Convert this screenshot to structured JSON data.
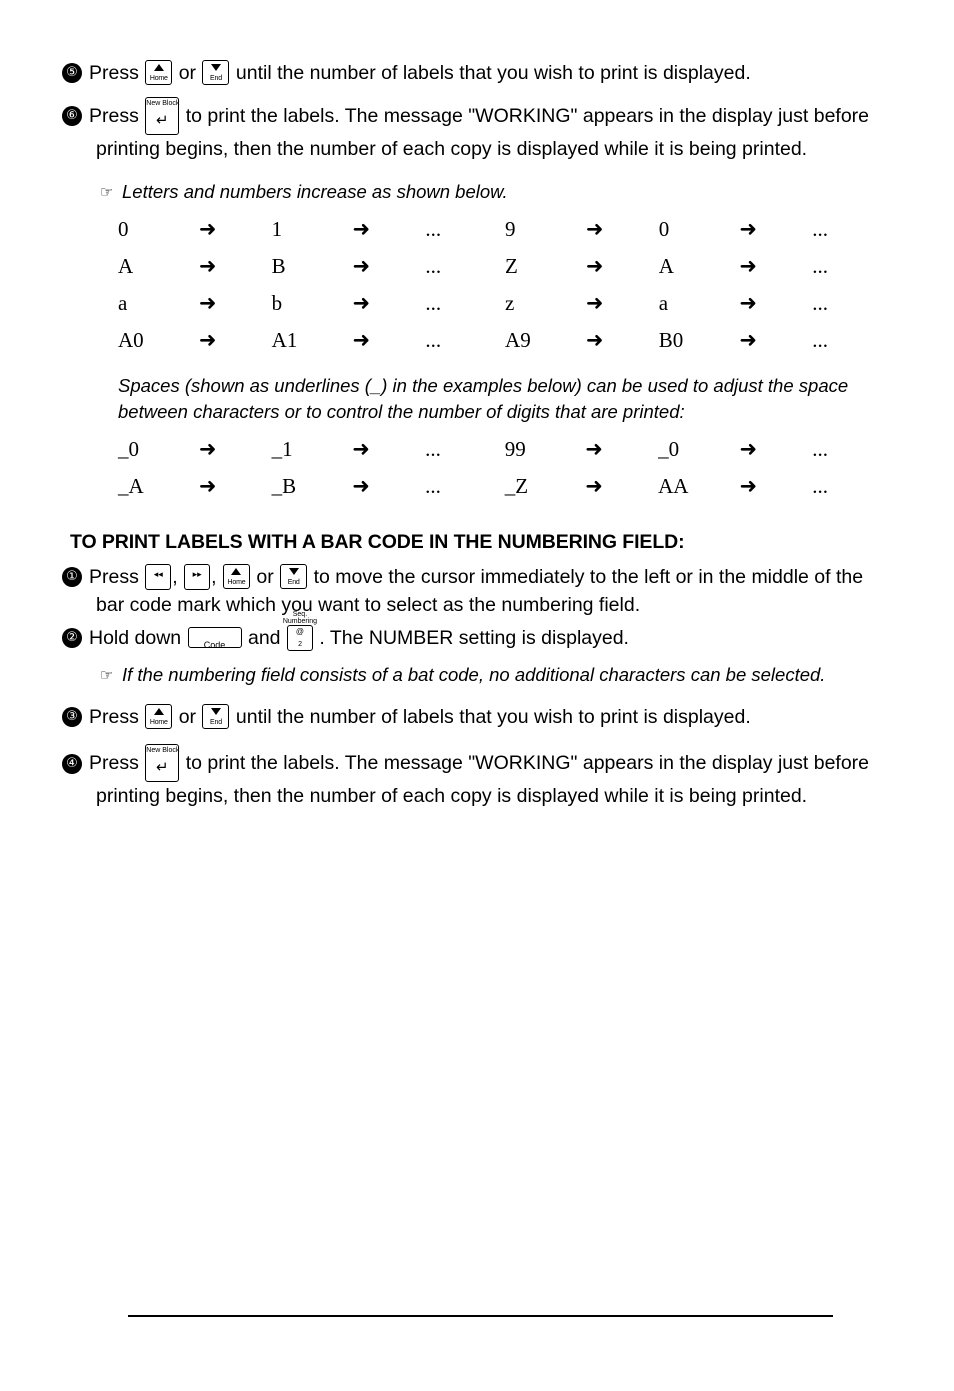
{
  "document": {
    "steps_part1": [
      {
        "num": "⑤",
        "text_before": "Press",
        "key1": "up-home",
        "conj": "or",
        "key2": "down-end",
        "text_after": "until the number of labels that you wish to print is displayed."
      },
      {
        "num": "⑥",
        "text_before": "Press",
        "key1": "new-block-enter",
        "text_after": "to print the labels.  The message \"WORKING\" appears in the display just before",
        "continuation": "printing begins, then the number of each copy is displayed while it is being printed."
      }
    ],
    "note1": "Letters and numbers increase as shown below.",
    "sequence_rows": [
      {
        "v1": "0",
        "v2": "1",
        "dots": "...",
        "v3": "9",
        "v4": "0",
        "dots2": "..."
      },
      {
        "v1": "A",
        "v2": "B",
        "dots": "...",
        "v3": "Z",
        "v4": "A",
        "dots2": "..."
      },
      {
        "v1": "a",
        "v2": "b",
        "dots": "...",
        "v3": "z",
        "v4": "a",
        "dots2": "..."
      },
      {
        "v1": "A0",
        "v2": "A1",
        "dots": "...",
        "v3": "A9",
        "v4": "B0",
        "dots2": "..."
      }
    ],
    "spaces_paragraph": "Spaces (shown as underlines (_) in the examples below) can be used to adjust the space between characters or to control the number of digits that are printed:",
    "sequence_rows2": [
      {
        "v1": "_0",
        "v2": "_1",
        "dots": "...",
        "v3": "99",
        "v4": "_0",
        "dots2": "..."
      },
      {
        "v1": "_A",
        "v2": "_B",
        "dots": "...",
        "v3": "_Z",
        "v4": "AA",
        "dots2": "..."
      }
    ],
    "section_heading": "TO PRINT LABELS WITH A BAR CODE IN THE NUMBERING FIELD:",
    "steps_part2": [
      {
        "num": "①",
        "text_before": "Press",
        "sep1": ",",
        "sep2": ",",
        "conj": "or",
        "text_after": "to move the cursor immediately to the left or in the middle of the",
        "continuation": "bar code mark which you want to select as the numbering field."
      },
      {
        "num": "②",
        "text_before": "Hold down",
        "conj": "and",
        "text_after": ".  The NUMBER setting is displayed."
      },
      {
        "num": "③",
        "text_before": "Press",
        "conj": "or",
        "text_after": "until the number of labels that you wish to print is displayed."
      },
      {
        "num": "④",
        "text_before": "Press",
        "text_after": "to print the labels.  The message \"WORKING\" appears in the display just before",
        "continuation": "printing begins, then the number of each copy is displayed while it is being printed."
      }
    ],
    "note2": "If the numbering field consists of a bat code, no additional characters can be selected.",
    "keys": {
      "home_label": "Home",
      "end_label": "End",
      "new_block_label": "New Block",
      "enter_glyph": "↵",
      "code_label": "Code",
      "seq_label": "Seq.",
      "numbering_label": "Numbering",
      "key2_top": "@",
      "key2_bottom": "2",
      "cursor_left_glyph": "◂◂",
      "cursor_right_glyph": "▸▸"
    },
    "arrow_glyph": "➜",
    "hand_glyph": "☞"
  }
}
